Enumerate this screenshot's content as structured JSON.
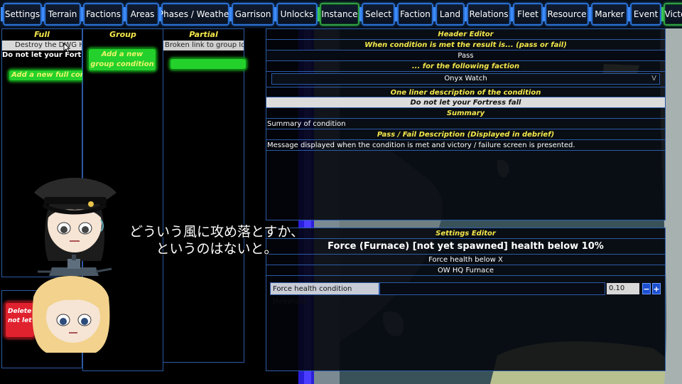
{
  "tabs": [
    {
      "label": "Settings",
      "variant": "blue"
    },
    {
      "label": "Terrain",
      "variant": "blue"
    },
    {
      "label": "Factions",
      "variant": "blue"
    },
    {
      "label": "Areas",
      "variant": "blue"
    },
    {
      "label": "Phases / Weather",
      "variant": "blue"
    },
    {
      "label": "Garrison",
      "variant": "blue"
    },
    {
      "label": "Unlocks",
      "variant": "blue"
    },
    {
      "label": "Instance",
      "variant": "green"
    },
    {
      "label": "Select",
      "variant": "blue"
    },
    {
      "label": "Faction",
      "variant": "blue"
    },
    {
      "label": "Land",
      "variant": "blue"
    },
    {
      "label": "Relations",
      "variant": "blue"
    },
    {
      "label": "Fleet",
      "variant": "blue"
    },
    {
      "label": "Resource",
      "variant": "blue"
    },
    {
      "label": "Marker",
      "variant": "blue"
    },
    {
      "label": "Event",
      "variant": "blue"
    },
    {
      "label": "Victory",
      "variant": "green"
    }
  ],
  "columns": {
    "full": {
      "title": "Full",
      "items": [
        "Destroy the DWG HQ",
        "Do not let your Fortress fall"
      ],
      "add_button": "Add a new full condition"
    },
    "group": {
      "title": "Group",
      "add_button": "Add a new group condition"
    },
    "partial": {
      "title": "Partial",
      "items": [
        "Broken link to group Id: I"
      ]
    },
    "delete_button": "Delete\nnot let"
  },
  "header_editor": {
    "title": "Header Editor",
    "result_label": "When condition is met the result is... (pass or fail)",
    "result_value": "Pass",
    "faction_label": "... for the following faction",
    "faction_value": "Onyx Watch",
    "oneliner_label": "One liner description of the condition",
    "oneliner_value": "Do not let your Fortress fall",
    "summary_label": "Summary",
    "summary_value": "Summary of condition",
    "passfail_label": "Pass / Fail Description (Displayed in debrief)",
    "passfail_value": "Message displayed when the condition is met and victory / failure screen is presented."
  },
  "settings_editor": {
    "title": "Settings Editor",
    "headline": "Force (Furnace) [not yet spawned] health below 10%",
    "type_value": "Force health below X",
    "target_value": "OW HQ Furnace",
    "threshold_label": "Force health condition threshold",
    "threshold_value": "0.10",
    "minus_label": "−",
    "plus_label": "+"
  },
  "subtitle": {
    "line1": "どういう風に攻め落とすか、",
    "line2": "というのはないと。"
  },
  "colors": {
    "accent_blue": "#2c5aa6",
    "header_yellow": "#f5e84a",
    "button_green": "#24d12c",
    "tab_green": "#2f9f45"
  }
}
